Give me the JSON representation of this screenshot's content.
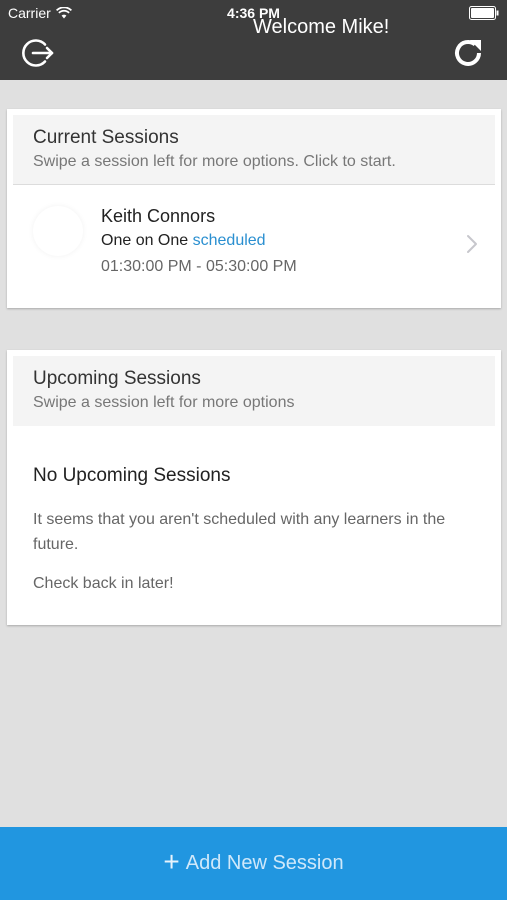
{
  "status_bar": {
    "carrier": "Carrier",
    "time": "4:36 PM"
  },
  "header": {
    "title": "Welcome Mike!",
    "left_icon": "logout-icon",
    "right_icon": "refresh-icon"
  },
  "current_sessions": {
    "title": "Current Sessions",
    "subtitle": "Swipe a session left for more options. Click to start.",
    "items": [
      {
        "name": "Keith Connors",
        "type": "One on One",
        "status": "scheduled",
        "time": "01:30:00 PM - 05:30:00 PM"
      }
    ]
  },
  "upcoming_sessions": {
    "title": "Upcoming Sessions",
    "subtitle": "Swipe a session left for more options",
    "empty_title": "No Upcoming Sessions",
    "empty_text": "It seems that you aren't scheduled with any learners in the future.",
    "empty_text_2": "Check back in later!"
  },
  "footer": {
    "add_label": "Add New Session",
    "plus": "+"
  },
  "colors": {
    "header_bg": "#3d3d3d",
    "accent": "#2196e0",
    "status_scheduled": "#2a8fd0",
    "page_bg": "#e0e0e0"
  }
}
